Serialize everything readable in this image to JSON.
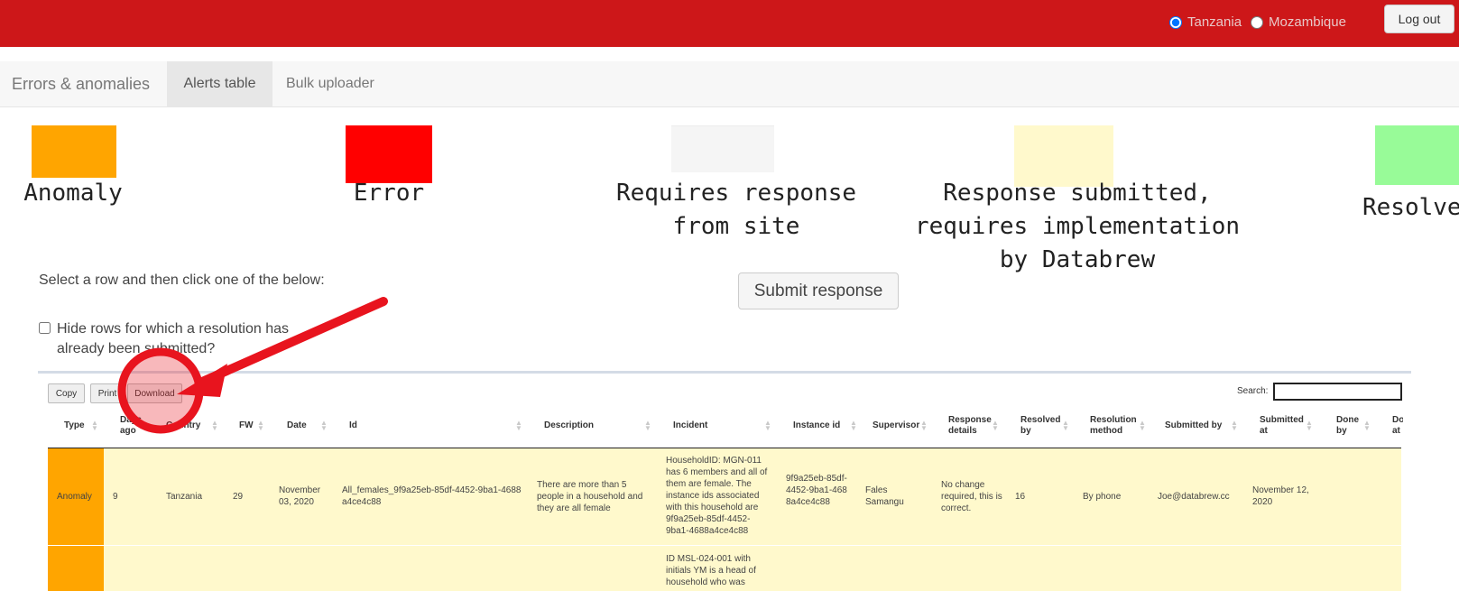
{
  "header": {
    "countries": [
      {
        "label": "Tanzania",
        "selected": true
      },
      {
        "label": "Mozambique",
        "selected": false
      }
    ],
    "logout_label": "Log out"
  },
  "nav": {
    "brand": "Errors & anomalies",
    "tabs": [
      {
        "label": "Alerts table",
        "active": true
      },
      {
        "label": "Bulk uploader",
        "active": false
      }
    ]
  },
  "legend": [
    {
      "label": "Anomaly",
      "color": "#ffa500"
    },
    {
      "label": "Error",
      "color": "#ff0000"
    },
    {
      "label": "Requires response\nfrom site",
      "color": "#f5f5f5"
    },
    {
      "label": "Response submitted,\nrequires implementation\nby Databrew",
      "color": "#fff9cc"
    },
    {
      "label": "Resolve",
      "color": "#98fb98"
    }
  ],
  "instructions": "Select a row and then click one of the below:",
  "submit_label": "Submit response",
  "hide_resolved_label": "Hide rows for which a resolution has already been submitted?",
  "table_tools": {
    "copy": "Copy",
    "print": "Print",
    "download": "Download",
    "search_label": "Search:"
  },
  "columns": [
    "Type",
    "Days ago",
    "Country",
    "FW",
    "Date",
    "Id",
    "Description",
    "Incident",
    "Instance id",
    "Supervisor",
    "Response details",
    "Resolved by",
    "Resolution method",
    "Submitted by",
    "Submitted at",
    "Done by",
    "Done at"
  ],
  "rows": [
    {
      "type": "Anomaly",
      "days_ago": "9",
      "country": "Tanzania",
      "fw": "29",
      "date": "November 03, 2020",
      "id": "All_females_9f9a25eb-85df-4452-9ba1-4688a4ce4c88",
      "description": "There are more than 5 people in a household and they are all female",
      "incident": "HouseholdID: MGN-011 has 6 members and all of them are female. The instance ids associated with this household are 9f9a25eb-85df-4452-9ba1-4688a4ce4c88",
      "instance_id": "9f9a25eb-85df-4452-9ba1-4688a4ce4c88",
      "supervisor": "Fales Samangu",
      "response_details": "No change required, this is correct.",
      "resolved_by": "16",
      "resolution_method": "By phone",
      "submitted_by": "Joe@databrew.cc",
      "submitted_at": "November 12, 2020",
      "color": "#fff9cc"
    },
    {
      "type": "Anomaly",
      "incident": "ID MSL-024-001 with initials YM is a head of household who was",
      "color": "#fff9cc"
    }
  ],
  "colors": {
    "topbar": "#cd1719",
    "annotation": "#e8141e"
  }
}
